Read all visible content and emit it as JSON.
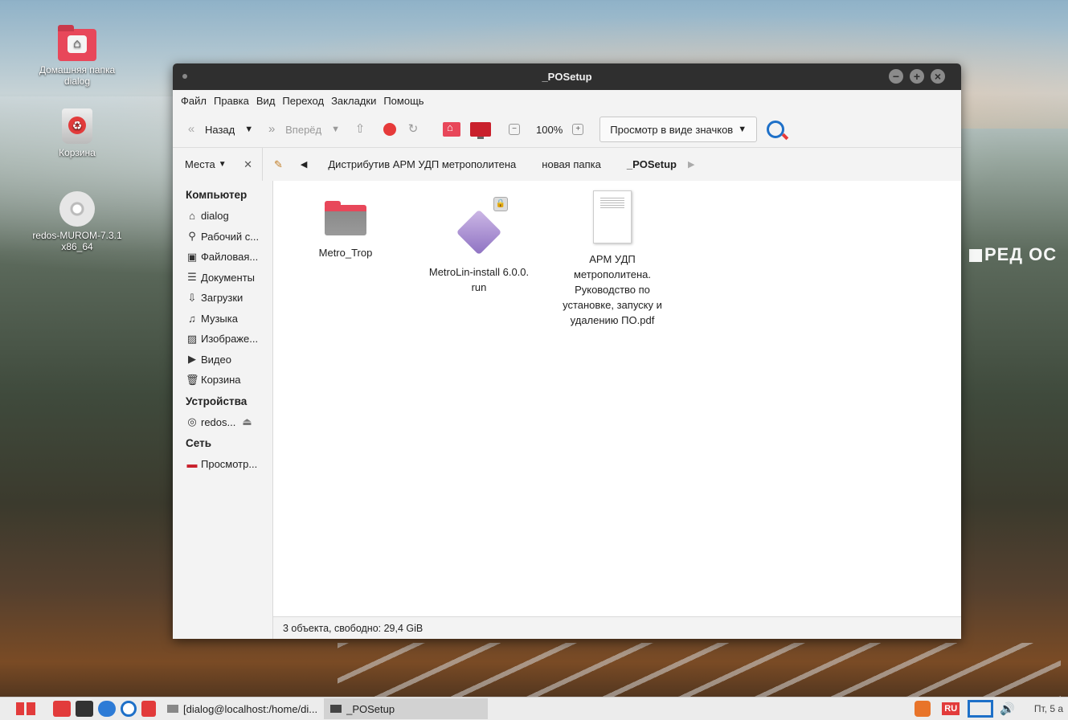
{
  "desktop": {
    "icons": [
      {
        "label1": "Домашняя папка",
        "label2": "dialog"
      },
      {
        "label1": "Корзина"
      },
      {
        "label1": "redos-MUROM-7.3.1",
        "label2": "x86_64"
      }
    ],
    "wallpaper_logo": "РЕД ОС"
  },
  "window": {
    "title": "_POSetup",
    "menu": [
      "Файл",
      "Правка",
      "Вид",
      "Переход",
      "Закладки",
      "Помощь"
    ],
    "toolbar": {
      "back": "Назад",
      "forward": "Вперёд",
      "zoom": "100%",
      "view_mode": "Просмотр в виде значков"
    },
    "places_label": "Места",
    "breadcrumbs": [
      "Дистрибутив АРМ УДП метрополитена",
      "новая папка",
      "_POSetup"
    ],
    "sidebar": {
      "computer_header": "Компьютер",
      "computer": [
        {
          "icon": "home-icon",
          "label": "dialog"
        },
        {
          "icon": "desktop-icon",
          "label": "Рабочий с..."
        },
        {
          "icon": "drive-icon",
          "label": "Файловая..."
        },
        {
          "icon": "document-icon",
          "label": "Документы"
        },
        {
          "icon": "download-icon",
          "label": "Загрузки"
        },
        {
          "icon": "music-icon",
          "label": "Музыка"
        },
        {
          "icon": "image-icon",
          "label": "Изображе..."
        },
        {
          "icon": "video-icon",
          "label": "Видео"
        },
        {
          "icon": "trash-icon",
          "label": "Корзина"
        }
      ],
      "devices_header": "Устройства",
      "devices": [
        {
          "icon": "disc-icon",
          "label": "redos..."
        }
      ],
      "network_header": "Сеть",
      "network": [
        {
          "icon": "network-icon",
          "label": "Просмотр..."
        }
      ]
    },
    "files": [
      {
        "type": "folder",
        "lines": [
          "Metro_Trop"
        ]
      },
      {
        "type": "package",
        "lines": [
          "MetroLin-install 6.0.0.",
          "run"
        ]
      },
      {
        "type": "pdf",
        "lines": [
          "АРМ УДП",
          "метрополитена.",
          "Руководство по",
          "установке, запуску и",
          "удалению ПО.pdf"
        ]
      }
    ],
    "status": "3 объекта, свободно: 29,4 GiB"
  },
  "taskbar": {
    "tasks": [
      "[dialog@localhost:/home/di...",
      "_POSetup"
    ],
    "layout": "RU",
    "clock": "Пт, 5 а"
  },
  "colors": {
    "accent": "#e8475a",
    "titlebar": "#2f2f2f"
  }
}
